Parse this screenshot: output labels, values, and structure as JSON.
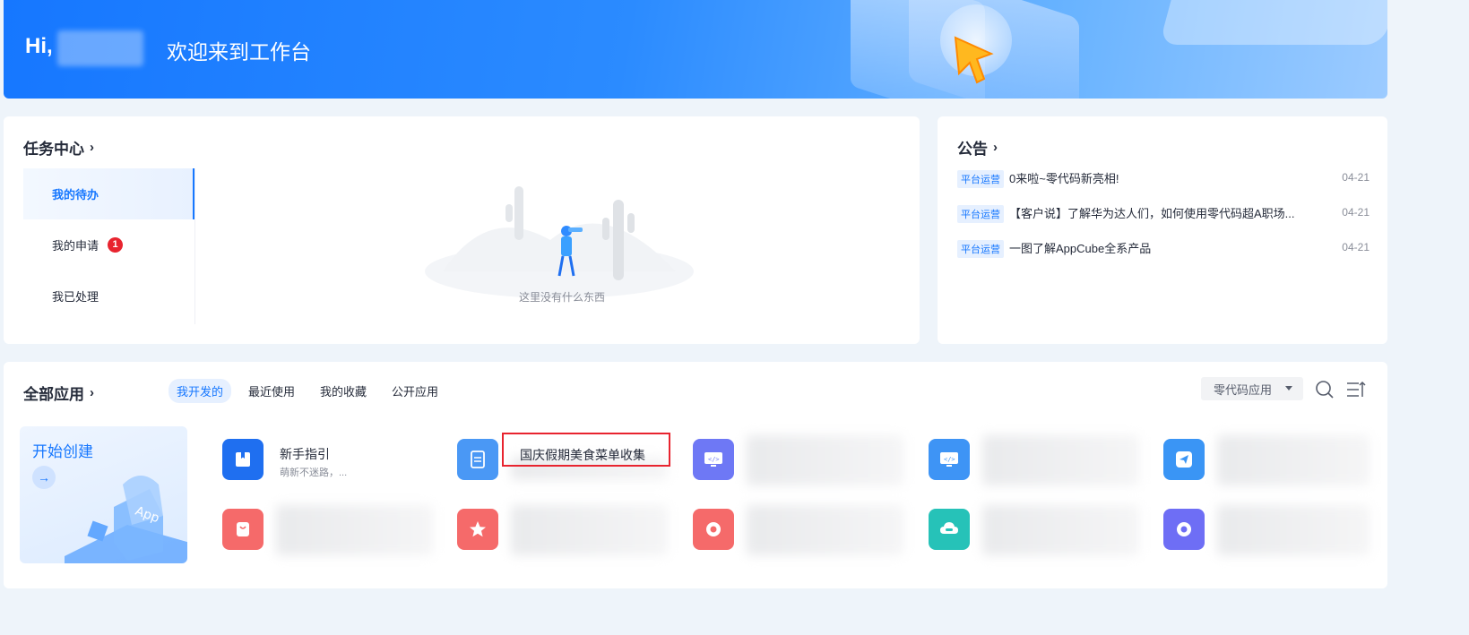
{
  "banner": {
    "greeting": "Hi,",
    "welcome": "欢迎来到工作台"
  },
  "tasks": {
    "title": "任务中心",
    "menu": [
      {
        "label": "我的待办",
        "active": true
      },
      {
        "label": "我的申请",
        "badge": "1"
      },
      {
        "label": "我已处理"
      }
    ],
    "empty_text": "这里没有什么东西"
  },
  "notices": {
    "title": "公告",
    "items": [
      {
        "tag": "平台运营",
        "text": "0来啦~零代码新亮相!",
        "date": "04-21"
      },
      {
        "tag": "平台运营",
        "text": "【客户说】了解华为达人们，如何使用零代码超A职场...",
        "date": "04-21"
      },
      {
        "tag": "平台运营",
        "text": "一图了解AppCube全系产品",
        "date": "04-21"
      }
    ]
  },
  "apps": {
    "title": "全部应用",
    "tabs": [
      "我开发的",
      "最近使用",
      "我的收藏",
      "公开应用"
    ],
    "active_tab": 0,
    "filter_value": "零代码应用",
    "create": {
      "label": "开始创建"
    },
    "list": [
      {
        "name": "新手指引",
        "desc": "萌新不迷路，...",
        "icon": "book-icon",
        "color": "#1f6ff0"
      },
      {
        "name": "国庆假期美食菜单收集",
        "desc": "",
        "icon": "document-icon",
        "color": "#4a98f5"
      },
      {
        "name": "",
        "desc": "",
        "icon": "code-icon",
        "color": "#6e78f5"
      },
      {
        "name": "",
        "desc": "",
        "icon": "code-icon",
        "color": "#3e94f5"
      },
      {
        "name": "",
        "desc": "",
        "icon": "send-icon",
        "color": "#3a95f5"
      },
      {
        "name": "",
        "desc": "",
        "icon": "bag-icon",
        "color": "#f56a6a"
      },
      {
        "name": "",
        "desc": "",
        "icon": "star-icon",
        "color": "#f56a6a"
      },
      {
        "name": "",
        "desc": "",
        "icon": "lifebuoy-icon",
        "color": "#f56a6a"
      },
      {
        "name": "",
        "desc": "",
        "icon": "cloud-icon",
        "color": "#26c2b8"
      },
      {
        "name": "",
        "desc": "",
        "icon": "lifebuoy-icon",
        "color": "#6e6ef5"
      }
    ]
  },
  "colors": {
    "accent": "#1677ff",
    "badge": "#e8242f"
  }
}
